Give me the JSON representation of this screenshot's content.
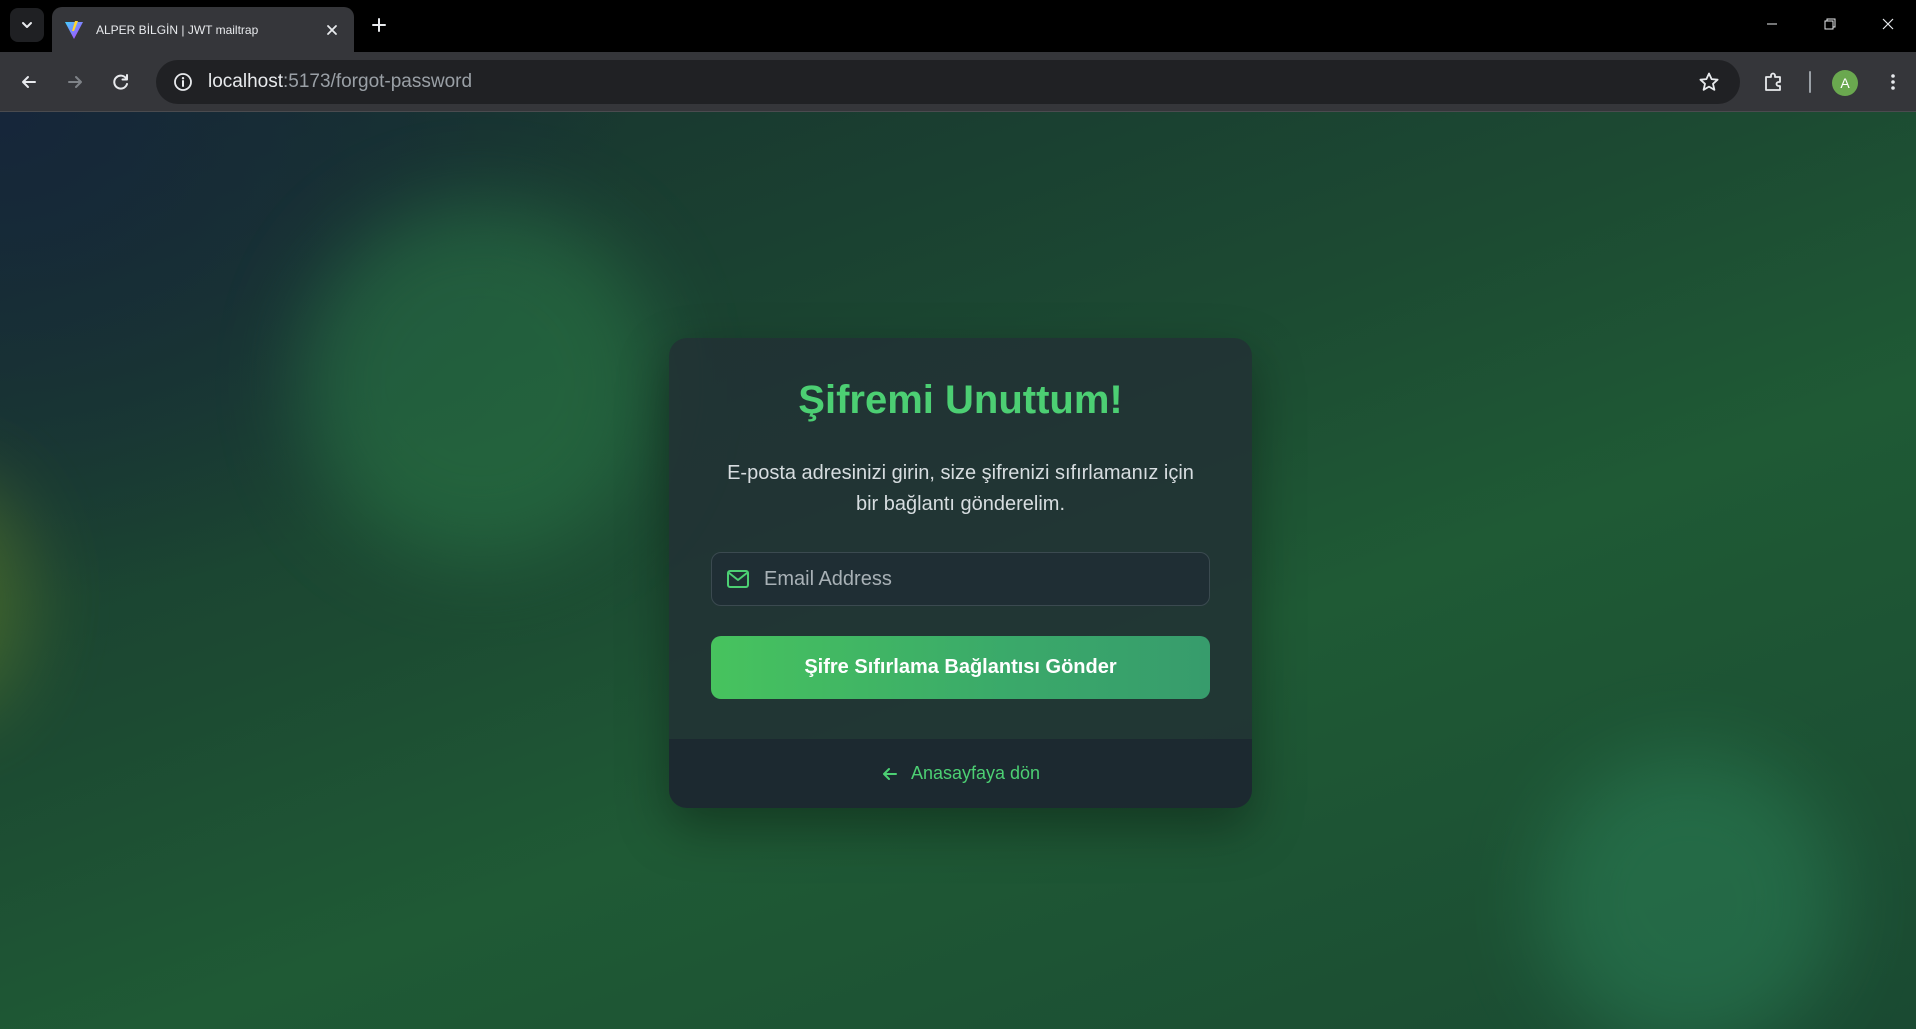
{
  "browser": {
    "tab_title": "ALPER BİLGİN | JWT mailtrap",
    "url_host": "localhost",
    "url_path": ":5173/forgot-password",
    "profile_initial": "A"
  },
  "page": {
    "title": "Şifremi Unuttum!",
    "subtitle": "E-posta adresinizi girin, size şifrenizi sıfırlamanız için bir bağlantı gönderelim.",
    "email_placeholder": "Email Address",
    "email_value": "",
    "submit_label": "Şifre Sıfırlama Bağlantısı Gönder",
    "back_link_label": "Anasayfaya dön"
  },
  "colors": {
    "accent": "#4ccf73",
    "button_gradient_start": "#47c35e",
    "button_gradient_end": "#379c6c"
  },
  "icons": {
    "tab_search": "chevron-down-icon",
    "favicon": "vite-logo-icon",
    "tab_close": "close-icon",
    "new_tab": "plus-icon",
    "back": "arrow-left-icon",
    "forward": "arrow-right-icon",
    "reload": "reload-icon",
    "site_info": "info-icon",
    "bookmark": "star-icon",
    "extensions": "puzzle-icon",
    "menu": "more-vert-icon",
    "email": "mail-icon",
    "back_link": "arrow-left-icon"
  }
}
